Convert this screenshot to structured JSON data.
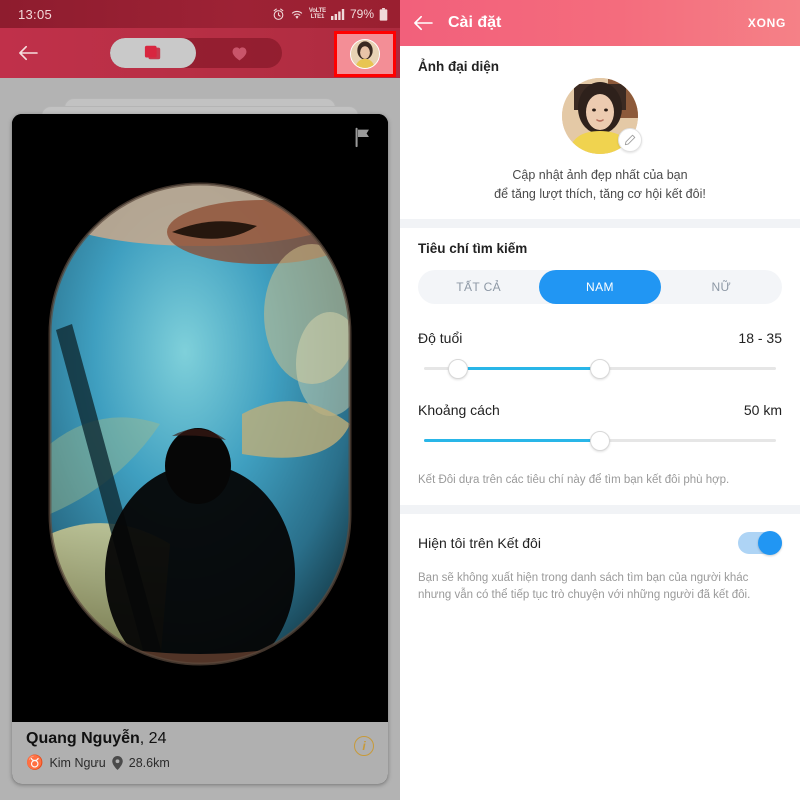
{
  "left": {
    "status_bar": {
      "time": "13:05",
      "battery": "79%",
      "network_label_top": "VoLTE",
      "network_label_bottom": "LTE1",
      "icons": [
        "alarm-icon",
        "wifi-icon",
        "volte-icon",
        "signal-icon",
        "battery-icon"
      ]
    },
    "app_bar": {
      "back_icon": "back-arrow-icon",
      "tabs": [
        {
          "icon": "cards-stack-icon",
          "active": true
        },
        {
          "icon": "heart-icon",
          "active": false
        }
      ],
      "profile_avatar": "profile-avatar",
      "highlight_color": "#ff0000"
    },
    "card": {
      "report_icon": "flag-icon",
      "name": "Quang Nguyễn",
      "age": ", 24",
      "zodiac_glyph": "♉",
      "zodiac": "Kim Ngưu",
      "distance": "28.6km",
      "info_icon": "i"
    }
  },
  "right": {
    "header": {
      "back_icon": "back-arrow-icon",
      "title": "Cài đặt",
      "done_label": "XONG"
    },
    "avatar_section": {
      "title": "Ảnh đại diện",
      "edit_icon": "pencil-icon",
      "caption_line1": "Cập nhật ảnh đẹp nhất của bạn",
      "caption_line2": "để tăng lượt thích, tăng cơ hội kết đôi!"
    },
    "criteria_section": {
      "title": "Tiêu chí tìm kiếm",
      "options": [
        {
          "label": "TẤT CẢ",
          "selected": false
        },
        {
          "label": "NAM",
          "selected": true
        },
        {
          "label": "NỮ",
          "selected": false
        }
      ],
      "selected_color": "#2196f3",
      "age": {
        "label": "Độ tuổi",
        "value": "18 - 35",
        "min_pct": 11,
        "max_pct": 50
      },
      "distance": {
        "label": "Khoảng cách",
        "value": "50 km",
        "fill_pct": 50
      },
      "helper": "Kết Đôi dựa trên các tiêu chí này để tìm bạn kết đôi phù hợp."
    },
    "visibility_section": {
      "label": "Hiện tôi trên Kết đôi",
      "toggle_on": true,
      "toggle_color": "#2196f3",
      "helper_line1": "Bạn sẽ không xuất hiện trong danh sách tìm bạn của người khác",
      "helper_line2": "nhưng vẫn có thể tiếp tục trò chuyện với những người đã kết đôi."
    }
  }
}
